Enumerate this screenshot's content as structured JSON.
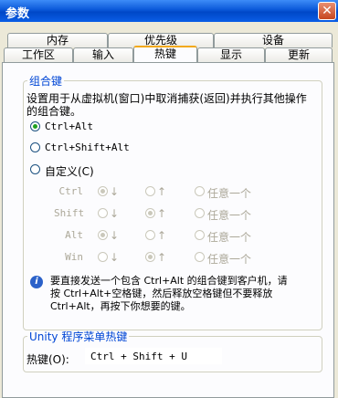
{
  "window": {
    "title": "参数",
    "close_label": "✕"
  },
  "tabs_row_back": [
    "内存",
    "优先级",
    "设备"
  ],
  "tabs_row_front": [
    "工作区",
    "输入",
    "热键",
    "显示",
    "更新"
  ],
  "hotkey_group": {
    "legend": "组合键",
    "description": [
      "设置用于从虚拟机(窗口)中取消捕获(返回)并执行其他操作",
      "的组合键。"
    ],
    "options": [
      "Ctrl+Alt",
      "Ctrl+Shift+Alt",
      "自定义(C)"
    ],
    "selected": "Ctrl+Alt",
    "mod_rows": [
      "Ctrl",
      "Shift",
      "Alt",
      "Win"
    ],
    "down_symbol": "↓",
    "up_symbol": "↑",
    "any_label": "任意一个",
    "info_text": [
      "要直接发送一个包含 Ctrl+Alt 的组合键到客户机，请",
      "按 Ctrl+Alt+空格键，然后释放空格键但不要释放",
      "Ctrl+Alt，再按下你想要的键。"
    ]
  },
  "unity_group": {
    "legend": "Unity 程序菜单热键",
    "hotkey_label": "热键(O):",
    "hotkey_value": "Ctrl + Shift + U"
  }
}
